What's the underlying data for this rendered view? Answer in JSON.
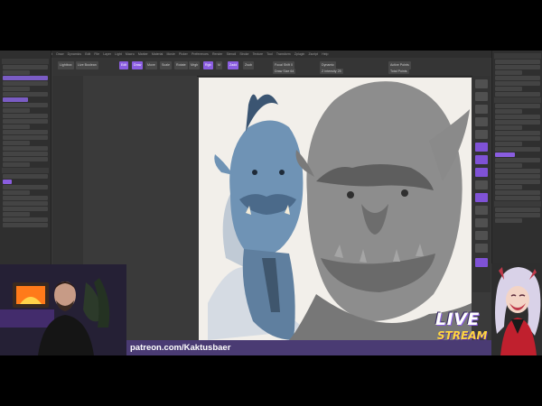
{
  "app": {
    "menu": [
      "Alpha",
      "Brush",
      "Color",
      "Document",
      "Draw",
      "Dynamics",
      "Edit",
      "File",
      "Layer",
      "Light",
      "Macro",
      "Marker",
      "Material",
      "Movie",
      "Picker",
      "Preferences",
      "Render",
      "Stencil",
      "Stroke",
      "Texture",
      "Tool",
      "Transform",
      "Zplugin",
      "Zscript",
      "Help"
    ]
  },
  "shelf": {
    "items": [
      "Lightbox",
      "Live Boolean",
      "Edit",
      "Draw",
      "Move",
      "Scale",
      "Rotate",
      "Mrgb",
      "Rgb",
      "M",
      "Zadd",
      "Zsub",
      "Focal Shift 0",
      "Draw Size 64",
      "Dynamic",
      "Z Intensity 25",
      "Active Points",
      "Total Points"
    ]
  },
  "stream": {
    "patreon": "patreon.com/Kaktusbaer",
    "live_line1": "LIVE",
    "live_line2": "STREAM"
  },
  "colors": {
    "accent": "#8a5de0",
    "banner": "#4a3b73",
    "live_yellow": "#ffd640"
  }
}
